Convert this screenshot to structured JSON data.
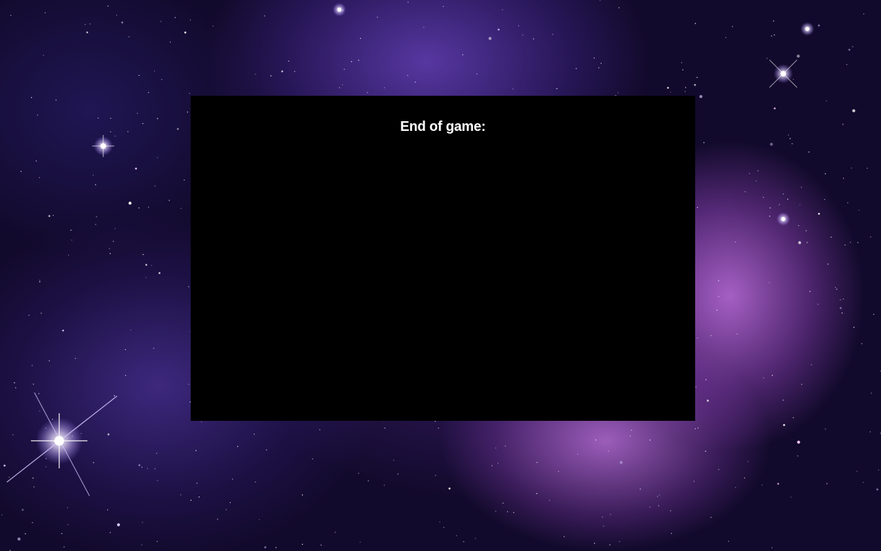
{
  "game": {
    "end_title": "End of game:"
  },
  "background": {
    "theme": "purple nebula starfield"
  },
  "colors": {
    "panel": "#000000",
    "text": "#ffffff",
    "nebula": "#b46fd8",
    "space": "#120a2c"
  }
}
